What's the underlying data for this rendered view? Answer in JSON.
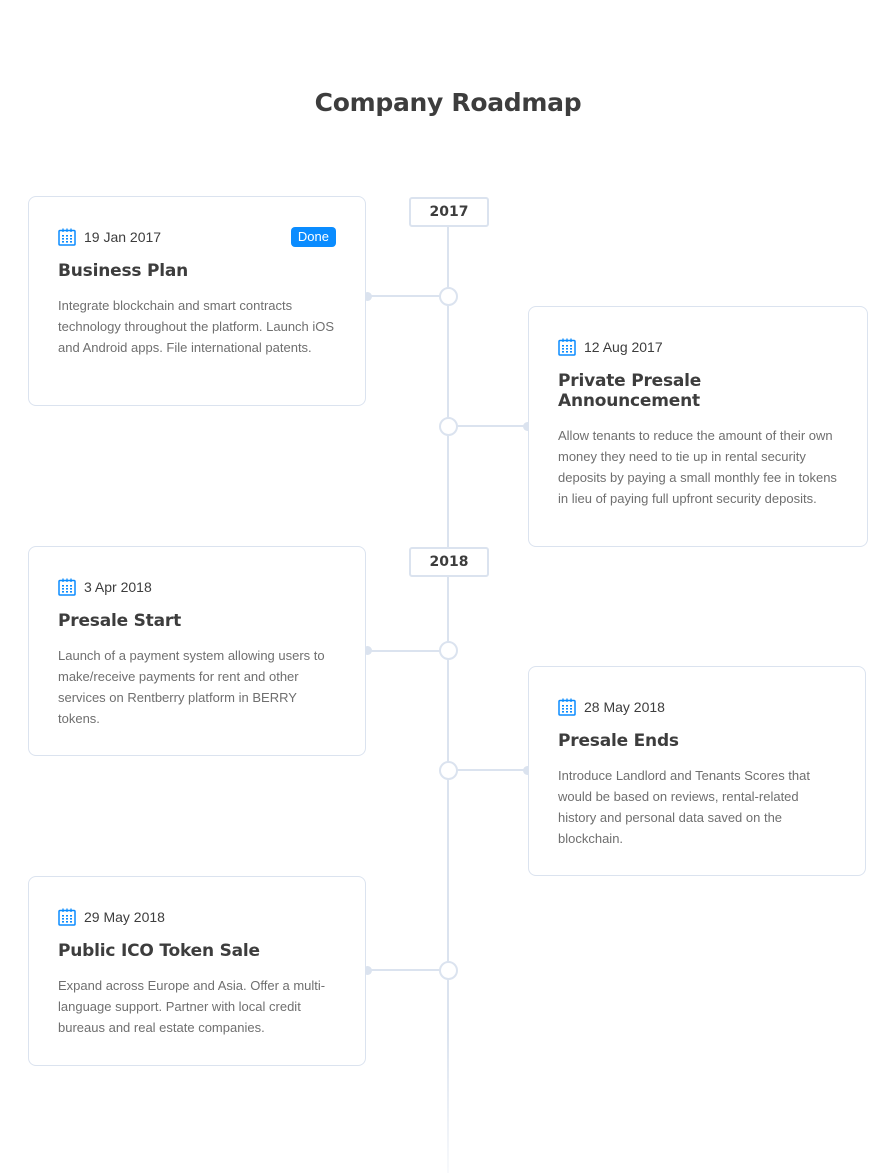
{
  "page": {
    "title": "Company Roadmap"
  },
  "colors": {
    "accent": "#0a8cff",
    "line": "#dbe3ef",
    "text": "#3d3d3d"
  },
  "years": [
    "2017",
    "2018"
  ],
  "milestones": [
    {
      "date": "19 Jan 2017",
      "badge": "Done",
      "title": "Business Plan",
      "description": "Integrate blockchain and smart contracts technology throughout the platform. Launch iOS and Android apps. File international patents.",
      "icon": "calendar-icon"
    },
    {
      "date": "12 Aug 2017",
      "title": "Private Presale Announcement",
      "description": "Allow tenants to reduce the amount of their own money they need to tie up in rental security deposits by paying a small monthly fee in tokens in lieu of paying full upfront security deposits.",
      "icon": "calendar-icon"
    },
    {
      "date": "3 Apr 2018",
      "title": "Presale Start",
      "description": "Launch of a payment system allowing users to make/receive payments for rent and other services on Rentberry platform in BERRY tokens.",
      "icon": "calendar-icon"
    },
    {
      "date": "28 May 2018",
      "title": "Presale Ends",
      "description": "Introduce Landlord and Tenants Scores that would be based on reviews, rental-related history and personal data saved on the blockchain.",
      "icon": "calendar-icon"
    },
    {
      "date": "29 May 2018",
      "title": "Public ICO Token Sale",
      "description": "Expand across Europe and Asia. Offer a multi-language support. Partner with local credit bureaus and real estate companies.",
      "icon": "calendar-icon"
    }
  ]
}
